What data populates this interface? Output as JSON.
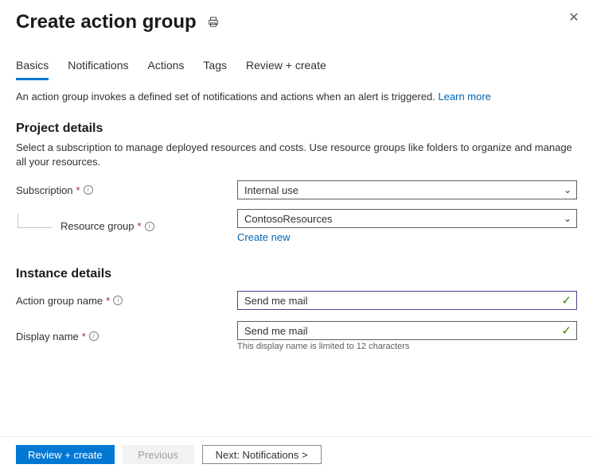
{
  "header": {
    "title": "Create action group"
  },
  "tabs": [
    {
      "label": "Basics",
      "active": true
    },
    {
      "label": "Notifications",
      "active": false
    },
    {
      "label": "Actions",
      "active": false
    },
    {
      "label": "Tags",
      "active": false
    },
    {
      "label": "Review + create",
      "active": false
    }
  ],
  "intro": {
    "text": "An action group invokes a defined set of notifications and actions when an alert is triggered. ",
    "link": "Learn more"
  },
  "project": {
    "title": "Project details",
    "description": "Select a subscription to manage deployed resources and costs. Use resource groups like folders to organize and manage all your resources.",
    "subscription": {
      "label": "Subscription",
      "value": "Internal use"
    },
    "resource_group": {
      "label": "Resource group",
      "value": "ContosoResources",
      "create_new": "Create new"
    }
  },
  "instance": {
    "title": "Instance details",
    "action_group_name": {
      "label": "Action group name",
      "value": "Send me mail"
    },
    "display_name": {
      "label": "Display name",
      "value": "Send me mail",
      "helper": "This display name is limited to 12 characters"
    }
  },
  "footer": {
    "review_create": "Review + create",
    "previous": "Previous",
    "next": "Next: Notifications >"
  }
}
